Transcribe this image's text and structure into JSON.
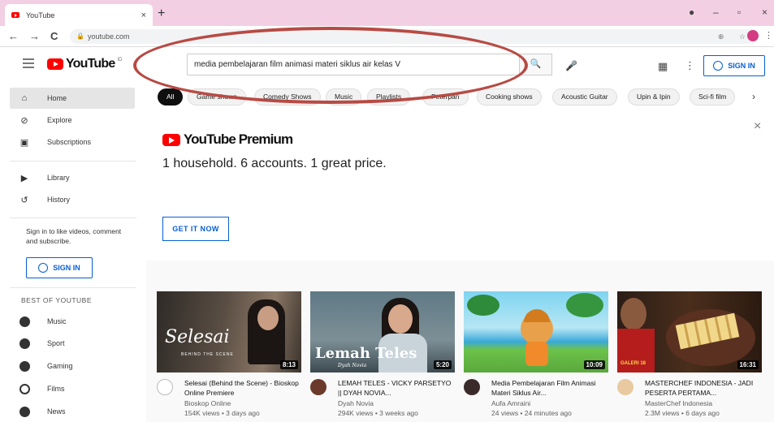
{
  "browser": {
    "tab_title": "YouTube",
    "tab_close": "×",
    "new_tab": "+",
    "url": "youtube.com",
    "nav": {
      "back": "←",
      "forward": "→",
      "reload": "C"
    },
    "omnibox_icons": "⊕ ☆",
    "window": {
      "minimize": "–",
      "maximize": "▫",
      "close": "×"
    }
  },
  "header": {
    "logo_text": "YouTube",
    "region": "ID",
    "search_value": "media pembelajaran film animasi materi siklus air kelas V",
    "search_icon": "🔍",
    "mic_icon": "🎤",
    "apps_icon": "▦",
    "menu_icon": "⋮",
    "signin_label": "SIGN IN"
  },
  "sidebar": {
    "items": [
      {
        "label": "Home",
        "icon": "⌂"
      },
      {
        "label": "Explore",
        "icon": "⊘"
      },
      {
        "label": "Subscriptions",
        "icon": "▣"
      },
      {
        "label": "Library",
        "icon": "▶"
      },
      {
        "label": "History",
        "icon": "↺"
      }
    ],
    "prompt": "Sign in to like videos, comment and subscribe.",
    "signin_label": "SIGN IN",
    "best_heading": "BEST OF YOUTUBE",
    "best_items": [
      {
        "label": "Music"
      },
      {
        "label": "Sport"
      },
      {
        "label": "Gaming"
      },
      {
        "label": "Films"
      },
      {
        "label": "News"
      }
    ]
  },
  "chips": {
    "items": [
      "All",
      "Game shows",
      "Comedy Shows",
      "Music",
      "Playlists",
      "Peterpan",
      "Cooking shows",
      "Acoustic Guitar",
      "Upin & Ipin",
      "Sci-fi film"
    ],
    "next_icon": "›"
  },
  "premium": {
    "logo_text": "YouTube Premium",
    "tagline": "1 household. 6 accounts. 1 great price.",
    "cta": "GET IT NOW",
    "close": "×"
  },
  "videos": [
    {
      "title": "Selesai (Behind the Scene) - Bioskop Online Premiere",
      "channel": "Bioskop Online",
      "stats": "154K views • 3 days ago",
      "duration": "8:13",
      "thumb_text": "Selesai",
      "thumb_sub": "BEHIND THE SCENE",
      "avatar_color": "#ffffff"
    },
    {
      "title": "LEMAH TELES - VICKY PARSETYO || DYAH NOVIA...",
      "channel": "Dyah Novia",
      "stats": "294K views • 3 weeks ago",
      "duration": "5:20",
      "thumb_text": "Lemah Teles",
      "thumb_sub": "Dyah Novia",
      "avatar_color": "#6b3a2a"
    },
    {
      "title": "Media Pembelajaran Film Animasi Materi Siklus Air...",
      "channel": "Aufa Amraini",
      "stats": "24 views • 24 minutes ago",
      "duration": "10:09",
      "thumb_text": "",
      "thumb_sub": "",
      "avatar_color": "#3b2a2a"
    },
    {
      "title": "MASTERCHEF INDONESIA - JADI PESERTA PERTAMA...",
      "channel": "MasterChef Indonesia",
      "stats": "2.3M views • 6 days ago",
      "duration": "16:31",
      "thumb_text": "",
      "thumb_sub": "GALERI 18",
      "avatar_color": "#e8c9a0"
    }
  ]
}
